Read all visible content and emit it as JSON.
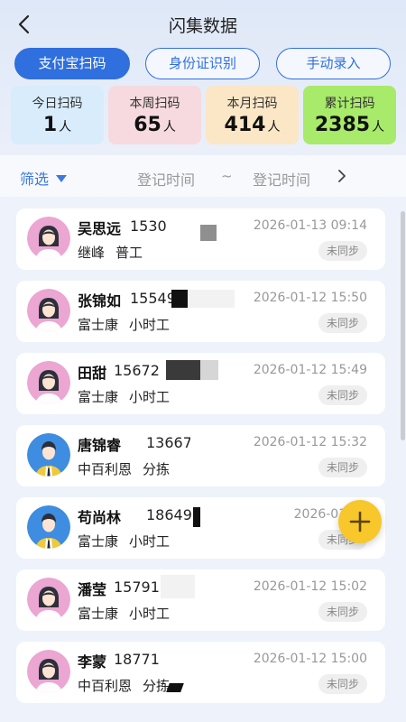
{
  "header": {
    "title": "闪集数据"
  },
  "modes": [
    {
      "label": "支付宝扫码",
      "active": true
    },
    {
      "label": "身份证识别",
      "active": false
    },
    {
      "label": "手动录入",
      "active": false
    }
  ],
  "stats": [
    {
      "label": "今日扫码",
      "value": "1",
      "unit": "人",
      "bg": "#d8ecfb"
    },
    {
      "label": "本周扫码",
      "value": "65",
      "unit": "人",
      "bg": "#f6dadf"
    },
    {
      "label": "本月扫码",
      "value": "414",
      "unit": "人",
      "bg": "#fbe7c6"
    },
    {
      "label": "累计扫码",
      "value": "2385",
      "unit": "人",
      "bg": "#a8ea6a"
    }
  ],
  "filter": {
    "label": "筛选",
    "start_placeholder": "登记时间",
    "separator": "~",
    "end_placeholder": "登记时间"
  },
  "records": [
    {
      "name": "吴思远",
      "phone": "1530",
      "company": "继峰",
      "type": "普工",
      "time": "2026-01-13 09:14",
      "status": "未同步",
      "avatar": "female"
    },
    {
      "name": "张锦如",
      "phone": "15549",
      "company": "富士康",
      "type": "小时工",
      "time": "2026-01-12 15:50",
      "status": "未同步",
      "avatar": "female"
    },
    {
      "name": "田甜",
      "phone": "15672",
      "company": "富士康",
      "type": "小时工",
      "time": "2026-01-12 15:49",
      "status": "未同步",
      "avatar": "female"
    },
    {
      "name": "唐锦睿",
      "phone": "136677",
      "company": "中百利恩",
      "type": "分拣",
      "time": "2026-01-12 15:32",
      "status": "未同步",
      "avatar": "male"
    },
    {
      "name": "苟尚林",
      "phone": "186499",
      "company": "富士康",
      "type": "小时工",
      "time": "2026-01-12",
      "status": "未同步",
      "avatar": "male"
    },
    {
      "name": "潘莹",
      "phone": "157919",
      "company": "富士康",
      "type": "小时工",
      "time": "2026-01-12 15:02",
      "status": "未同步",
      "avatar": "female"
    },
    {
      "name": "李蒙",
      "phone": "18771",
      "company": "中百利恩",
      "type": "分拣",
      "time": "2026-01-12 15:00",
      "status": "未同步",
      "avatar": "female"
    }
  ],
  "icons": {
    "back": "chevron-left-icon",
    "filter_arrow": "triangle-down-icon",
    "date_next": "chevron-right-icon",
    "fab": "plus-icon"
  },
  "colors": {
    "primary": "#2f6fde",
    "fab": "#f7c72b"
  }
}
